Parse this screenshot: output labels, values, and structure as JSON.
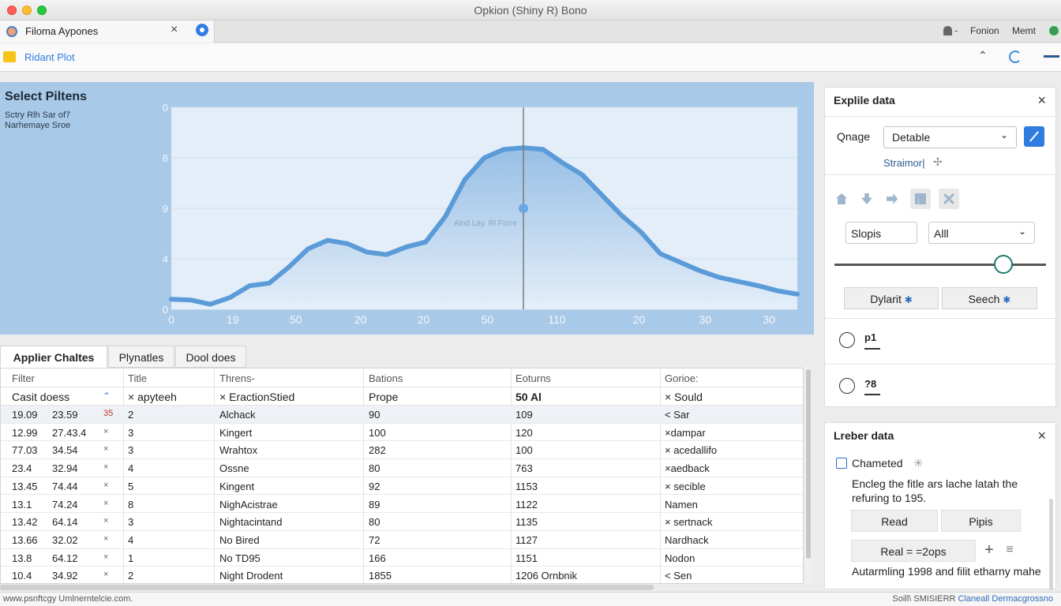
{
  "window": {
    "title": "Opkion (Shiny R) Bono"
  },
  "tab": {
    "label": "Filoma Aypones"
  },
  "topright": {
    "label1": "Fonion",
    "label2": "Memt"
  },
  "toolbar": {
    "label": "Ridant Plot"
  },
  "plot": {
    "title": "Select Piltens",
    "subtitle1": "Sctry Rlh Sar of7",
    "subtitle2": "Narhemaye Sroe",
    "annotation": "Alnd Lay. Rl Forre"
  },
  "chart_data": {
    "type": "area",
    "title": "",
    "xlabel": "",
    "ylabel": "",
    "x_tick_labels": [
      "0",
      "19",
      "50",
      "20",
      "20",
      "50",
      "110",
      "20",
      "30",
      "30"
    ],
    "y_tick_labels": [
      "0",
      "4",
      "9",
      "8",
      "0"
    ],
    "ylim": [
      0,
      12
    ],
    "series": [
      {
        "values": [
          0.6,
          0.55,
          0.3,
          0.7,
          1.4,
          1.55,
          2.5,
          3.6,
          4.1,
          3.9,
          3.4,
          3.25,
          3.7,
          4.0,
          5.5,
          7.7,
          9.0,
          9.5,
          9.6,
          9.5,
          8.7,
          8.0,
          6.8,
          5.6,
          4.6,
          3.3,
          2.8,
          2.3,
          1.9,
          1.65,
          1.4,
          1.1,
          0.9
        ]
      }
    ],
    "marker_index": 18,
    "marker_value": 6.0,
    "grid": true
  },
  "explore_panel": {
    "title": "Explile data",
    "select_label": "Qnage",
    "select_value": "Detable",
    "link": "Straimor|",
    "search_input": "Slopis",
    "filter_select": "Alll",
    "slider_value": 0.8,
    "btn1": "Dylarit",
    "btn2": "Seech",
    "radio1": "p1",
    "radio2": "?8"
  },
  "leader_panel": {
    "title": "Lreber data",
    "checkbox_label": "Chameted",
    "description": "Encleg the fitle ars lache latah the refuring to 195.",
    "btn1": "Read",
    "btn2": "Pipis",
    "btn3": "Real = =2ops",
    "note": "Autarmling 1998 and filit etharny mahe"
  },
  "tabs": [
    "Applier Chaltes",
    "Plynatles",
    "Dool does"
  ],
  "table": {
    "headers": [
      "Filter",
      "Title",
      "Threns-",
      "Bations",
      "Eoturns",
      "Gorioe:"
    ],
    "filter_row": [
      "Casit doess",
      "× apyteeh",
      "× EractionStied",
      "Prope",
      "50 Al",
      "× Sould"
    ],
    "rows": [
      [
        "19.09",
        "23.59",
        "35",
        "2",
        "Alchack",
        "90",
        "109",
        "< Sar"
      ],
      [
        "12.99",
        "27.43.4",
        "×",
        "3",
        "Kingert",
        "100",
        "120",
        "×dampar"
      ],
      [
        "77.03",
        "34.54",
        "×",
        "3",
        "Wrahtox",
        "282",
        "100",
        "× acedallifo"
      ],
      [
        "23.4",
        "32.94",
        "×",
        "4",
        "Ossne",
        "80",
        "763",
        "×aedback"
      ],
      [
        "13.45",
        "74.44",
        "×",
        "5",
        "Kingent",
        "92",
        "1153",
        "× secible"
      ],
      [
        "13.1",
        "74.24",
        "×",
        "8",
        "NighAcistrae",
        "89",
        "1122",
        "Namen"
      ],
      [
        "13.42",
        "64.14",
        "×",
        "3",
        "Nightacintand",
        "80",
        "1135",
        "× sertnack"
      ],
      [
        "13.66",
        "32.02",
        "×",
        "4",
        "No Bired",
        "72",
        "1127",
        "Nardhack"
      ],
      [
        "13.8",
        "64.12",
        "×",
        "1",
        "No TD95",
        "166",
        "1151",
        "Nodon"
      ],
      [
        "10.4",
        "34.92",
        "×",
        "2",
        "Night Drodent",
        "1855",
        "1206 Ornbnik",
        "< Sen"
      ]
    ]
  },
  "status": {
    "left": "www.psnftcgy Umlnerntelcie.com.",
    "right_a": "Soill\\ SMISIERR",
    "right_b": "Claneall Dermacgrossno"
  }
}
